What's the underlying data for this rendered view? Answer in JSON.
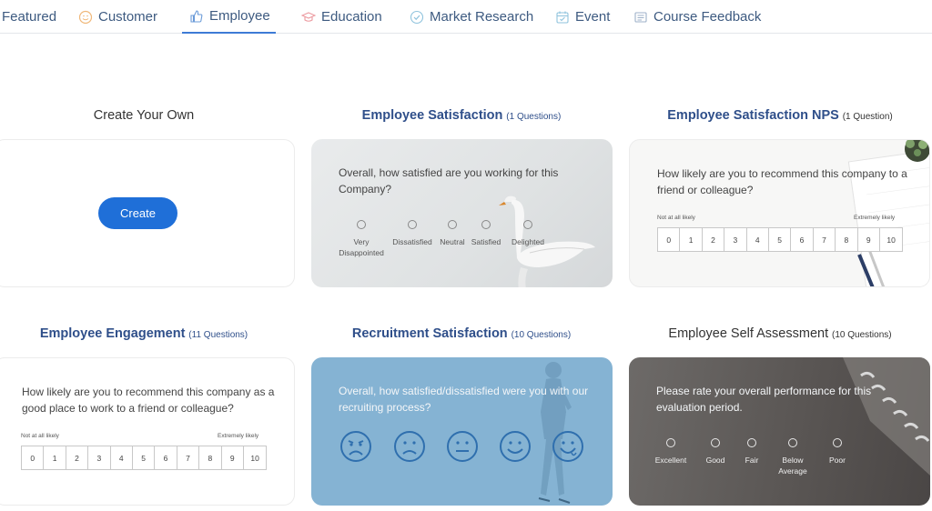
{
  "tabs": [
    {
      "label": "Featured",
      "icon": "none"
    },
    {
      "label": "Customer",
      "icon": "smiley-icon"
    },
    {
      "label": "Employee",
      "icon": "thumbs-up-icon",
      "active": true
    },
    {
      "label": "Education",
      "icon": "graduation-cap-icon"
    },
    {
      "label": "Market Research",
      "icon": "checkmark-shield-icon"
    },
    {
      "label": "Event",
      "icon": "calendar-icon"
    },
    {
      "label": "Course Feedback",
      "icon": "document-icon"
    }
  ],
  "cards": {
    "create": {
      "title": "Create Your Own",
      "button": "Create"
    },
    "satisfaction": {
      "title": "Employee Satisfaction",
      "count": "(1 Questions)",
      "question": "Overall, how satisfied are you working for this Company?",
      "options": [
        "Very Disappointed",
        "Dissatisfied",
        "Neutral",
        "Satisfied",
        "Delighted"
      ]
    },
    "nps": {
      "title": "Employee Satisfaction NPS",
      "count": "(1 Question)",
      "question": "How likely are you to recommend this company to a friend or colleague?",
      "low_label": "Not at all likely",
      "high_label": "Extremely likely",
      "scale": [
        "0",
        "1",
        "2",
        "3",
        "4",
        "5",
        "6",
        "7",
        "8",
        "9",
        "10"
      ]
    },
    "engagement": {
      "title": "Employee Engagement",
      "count": "(11 Questions)",
      "question": "How likely are you to recommend this company as a good place to work to a friend or colleague?",
      "low_label": "Not at all likely",
      "high_label": "Extremely likely",
      "scale": [
        "0",
        "1",
        "2",
        "3",
        "4",
        "5",
        "6",
        "7",
        "8",
        "9",
        "10"
      ]
    },
    "recruitment": {
      "title": "Recruitment Satisfaction",
      "count": "(10 Questions)",
      "question": "Overall, how satisfied/dissatisfied were you with our recruiting process?",
      "faces": [
        "angry-face-icon",
        "sad-face-icon",
        "neutral-face-icon",
        "happy-face-icon",
        "delighted-face-icon"
      ]
    },
    "self_assessment": {
      "title": "Employee Self Assessment",
      "count": "(10 Questions)",
      "question": "Please rate your overall performance for this evaluation period.",
      "options": [
        "Excellent",
        "Good",
        "Fair",
        "Below Average",
        "Poor"
      ]
    }
  },
  "colors": {
    "accent": "#1f6fd8",
    "title_blue": "#2f4f8a",
    "recruit_bg": "#85b3d3"
  }
}
